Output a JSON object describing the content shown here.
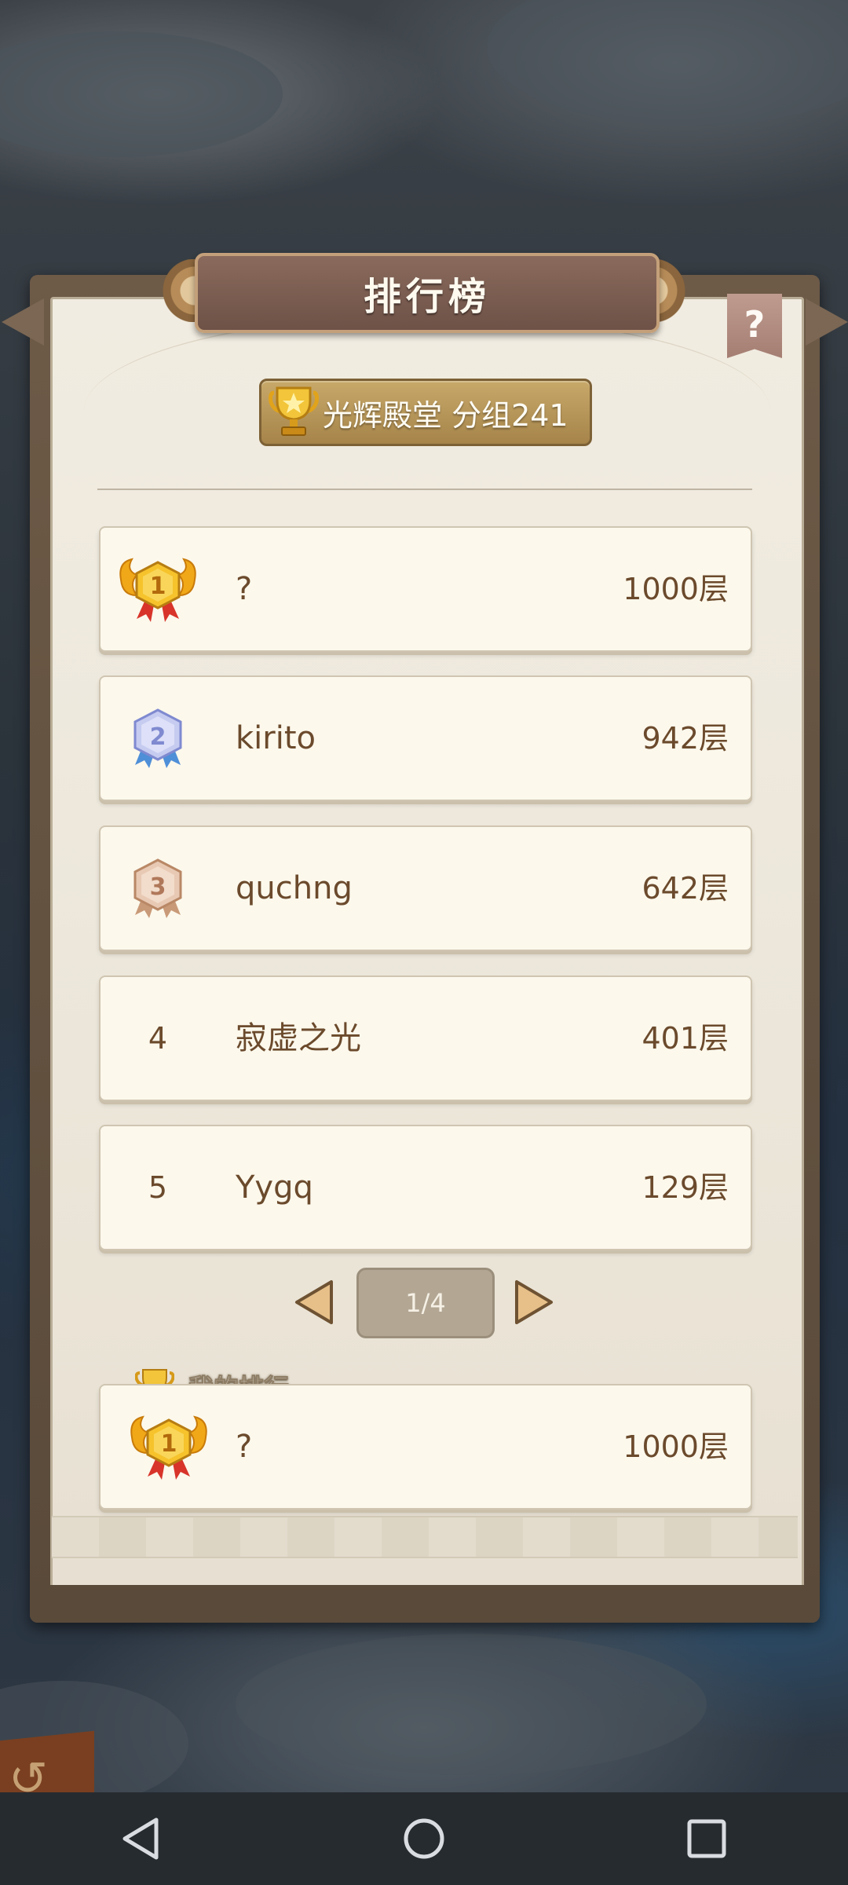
{
  "title": "排行榜",
  "help_label": "?",
  "group": "光辉殿堂 分组241",
  "rankings": [
    {
      "rank": "1",
      "name": "?",
      "score": "1000层",
      "medal": "gold"
    },
    {
      "rank": "2",
      "name": "kirito",
      "score": "942层",
      "medal": "silver"
    },
    {
      "rank": "3",
      "name": "quchng",
      "score": "642层",
      "medal": "bronze"
    },
    {
      "rank": "4",
      "name": "寂虚之光",
      "score": "401层",
      "medal": null
    },
    {
      "rank": "5",
      "name": "Yygq",
      "score": "129层",
      "medal": null
    }
  ],
  "pagination": {
    "label": "1/4"
  },
  "my_rank": {
    "label": "我的排行",
    "rank": "1",
    "name": "?",
    "score": "1000层",
    "medal": "gold"
  },
  "icons": {
    "trophy": "trophy-icon",
    "gold_medal": "gold-medal-icon",
    "silver_medal": "silver-medal-icon",
    "bronze_medal": "bronze-medal-icon",
    "prev": "triangle-left-icon",
    "next": "triangle-right-icon",
    "nav_back": "nav-back-icon",
    "nav_home": "nav-home-icon",
    "nav_recents": "nav-recents-icon"
  },
  "colors": {
    "panel": "#ece6da",
    "row": "#fcf8ec",
    "text_brown": "#6b4a2c",
    "banner": "#7a5c50",
    "gold": "#f2b823"
  }
}
